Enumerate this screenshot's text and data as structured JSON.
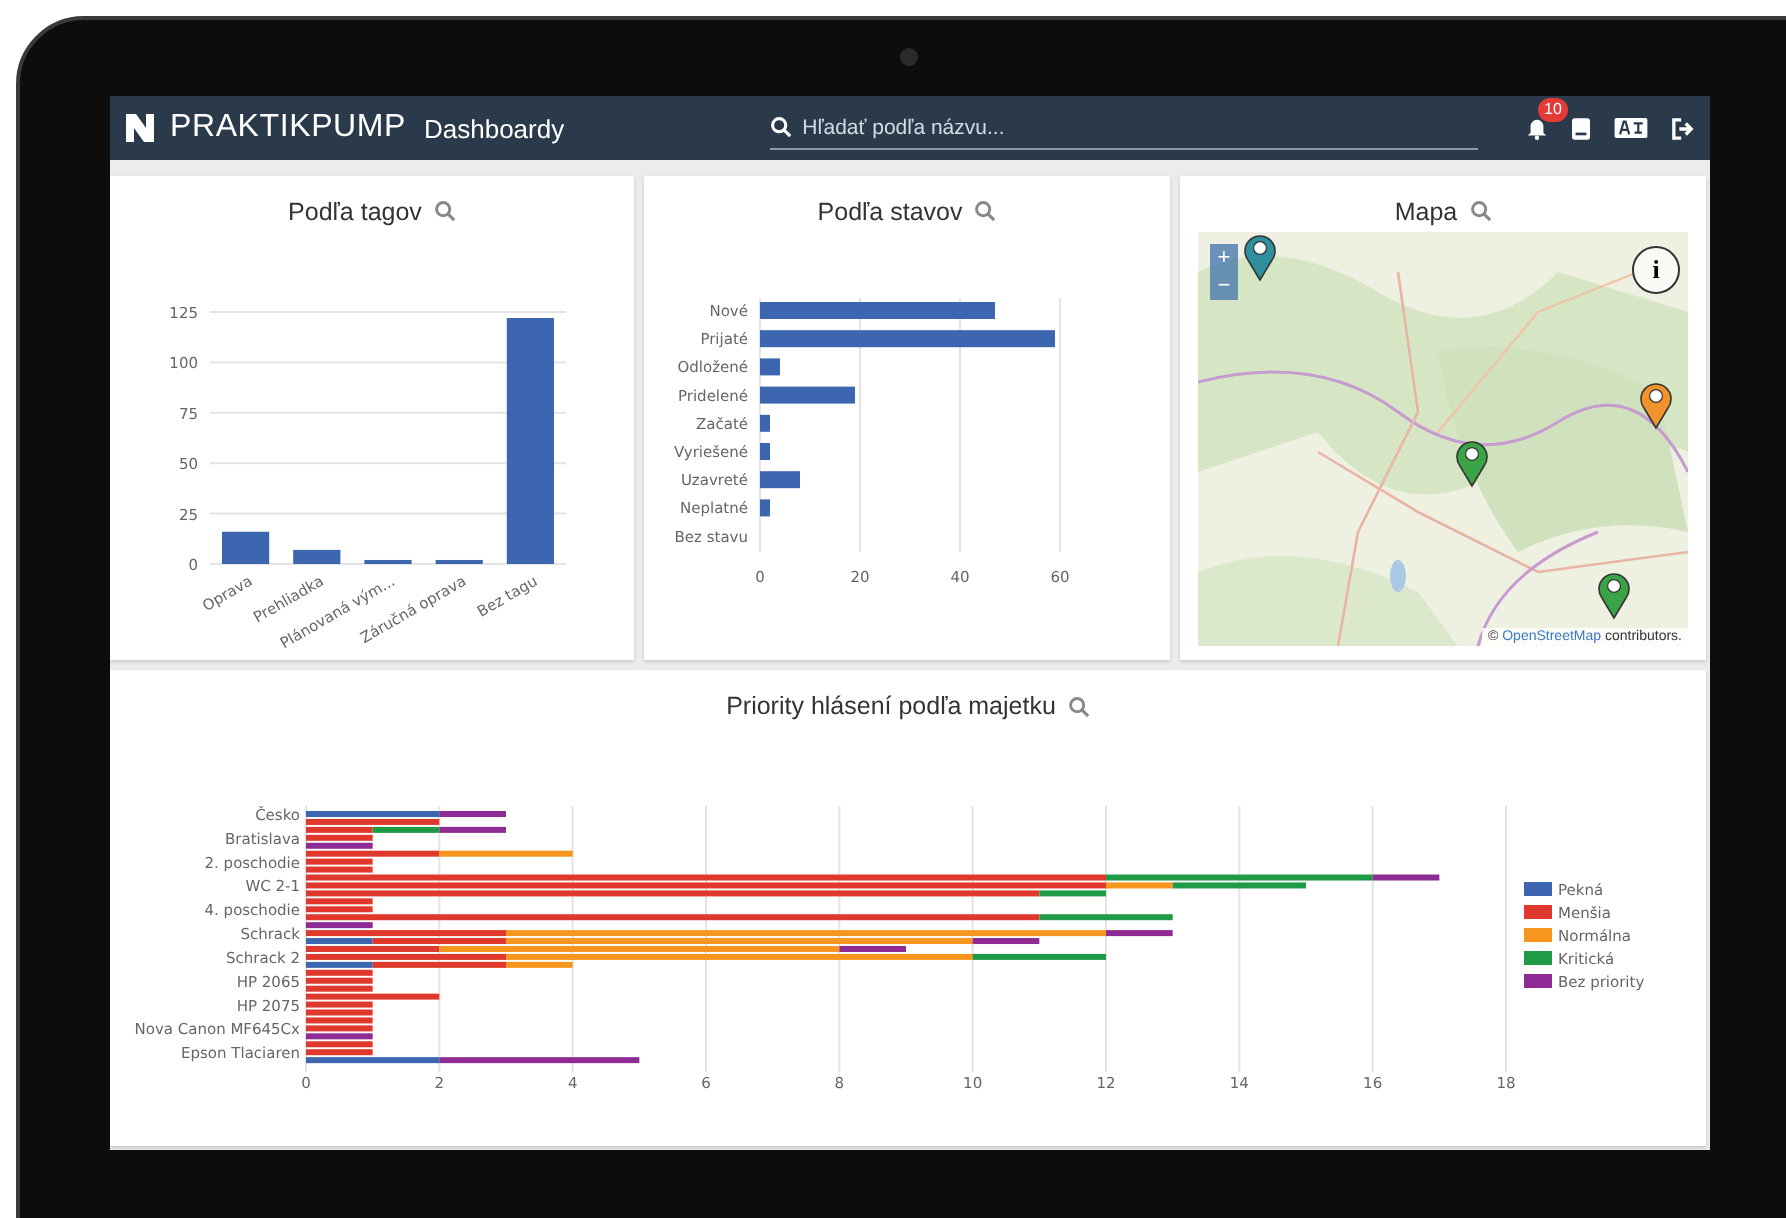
{
  "header": {
    "logo": "PRAKTIK**PUMP**",
    "title": "Dashboardy",
    "search": {
      "placeholder": "Hľadať podľa názvu..."
    },
    "notification_count": "10"
  },
  "tags_card": {
    "title": "Podľa tagov",
    "chart_data": {
      "type": "bar",
      "grid": true,
      "categories": [
        "Oprava",
        "Prehliadka",
        "Plánovaná vým...",
        "Záručná oprava",
        "Bez tagu"
      ],
      "series": [
        {
          "color": "#3d66b0",
          "values": [
            16,
            7,
            2,
            2,
            122
          ]
        }
      ],
      "ylim": [
        0,
        125
      ],
      "yticks": [
        0,
        25,
        50,
        75,
        100,
        125
      ]
    }
  },
  "states_card": {
    "title": "Podľa stavov",
    "chart_data": {
      "type": "bar",
      "orientation": "horizontal",
      "grid": true,
      "categories": [
        "Nové",
        "Prijaté",
        "Odložené",
        "Pridelené",
        "Začaté",
        "Vyriešené",
        "Uzavreté",
        "Neplatné",
        "Bez stavu"
      ],
      "series": [
        {
          "color": "#3d66b0",
          "values": [
            47,
            59,
            4,
            19,
            2,
            2,
            8,
            2,
            0
          ]
        }
      ],
      "xlim": [
        0,
        60
      ],
      "xticks": [
        0,
        20,
        40,
        60
      ]
    }
  },
  "map_card": {
    "title": "Mapa",
    "zoom_in": "+",
    "zoom_out": "−",
    "info": "i",
    "markers": [
      {
        "color": "#2f8f9d"
      },
      {
        "color": "#f0932b"
      },
      {
        "color": "#3aa346"
      },
      {
        "color": "#3aa346"
      }
    ],
    "attribution": {
      "prefix": "©",
      "link": "OpenStreetMap",
      "suffix": "contributors."
    }
  },
  "priority_card": {
    "title": "Priority hlásení podľa majetku",
    "chart_data": {
      "type": "bar",
      "orientation": "horizontal",
      "stacked": true,
      "grid": true,
      "legend": "right",
      "categories": [
        "Česko",
        null,
        null,
        "Bratislava",
        null,
        null,
        "2. poschodie",
        null,
        null,
        "WC 2-1",
        null,
        null,
        "4. poschodie",
        null,
        null,
        "Schrack",
        null,
        null,
        "Schrack 2",
        null,
        null,
        "HP 2065",
        null,
        null,
        "HP 2075",
        null,
        null,
        "Nova Canon MF645Cx",
        null,
        null,
        "Epson Tlaciaren",
        null
      ],
      "series": [
        {
          "name": "Pekná",
          "color": "#3d66b0",
          "values": [
            2,
            0,
            0,
            0,
            0,
            0,
            0,
            0,
            0,
            0,
            0,
            0,
            0,
            0,
            0,
            0,
            1,
            0,
            0,
            1,
            0,
            0,
            0,
            0,
            0,
            0,
            0,
            0,
            0,
            0,
            0,
            2
          ]
        },
        {
          "name": "Menšia",
          "color": "#e0382c",
          "values": [
            0,
            2,
            1,
            1,
            0,
            2,
            1,
            1,
            12,
            12,
            11,
            1,
            1,
            11,
            0,
            3,
            2,
            2,
            3,
            2,
            1,
            1,
            1,
            2,
            1,
            1,
            1,
            1,
            0,
            1,
            1,
            0
          ]
        },
        {
          "name": "Normálna",
          "color": "#f7961e",
          "values": [
            0,
            0,
            0,
            0,
            0,
            2,
            0,
            0,
            0,
            1,
            0,
            0,
            0,
            0,
            0,
            9,
            7,
            6,
            7,
            1,
            0,
            0,
            0,
            0,
            0,
            0,
            0,
            0,
            0,
            0,
            0,
            0
          ]
        },
        {
          "name": "Kritická",
          "color": "#1f9a46",
          "values": [
            0,
            0,
            1,
            0,
            0,
            0,
            0,
            0,
            4,
            2,
            1,
            0,
            0,
            2,
            0,
            0,
            0,
            0,
            2,
            0,
            0,
            0,
            0,
            0,
            0,
            0,
            0,
            0,
            0,
            0,
            0,
            0
          ]
        },
        {
          "name": "Bez priority",
          "color": "#8e2b94",
          "values": [
            1,
            0,
            1,
            0,
            1,
            0,
            0,
            0,
            1,
            0,
            0,
            0,
            0,
            0,
            1,
            1,
            1,
            1,
            0,
            0,
            0,
            0,
            0,
            0,
            0,
            0,
            0,
            0,
            1,
            0,
            0,
            3
          ]
        }
      ],
      "xlim": [
        0,
        18
      ],
      "xticks": [
        0,
        2,
        4,
        6,
        8,
        10,
        12,
        14,
        16,
        18
      ]
    }
  }
}
